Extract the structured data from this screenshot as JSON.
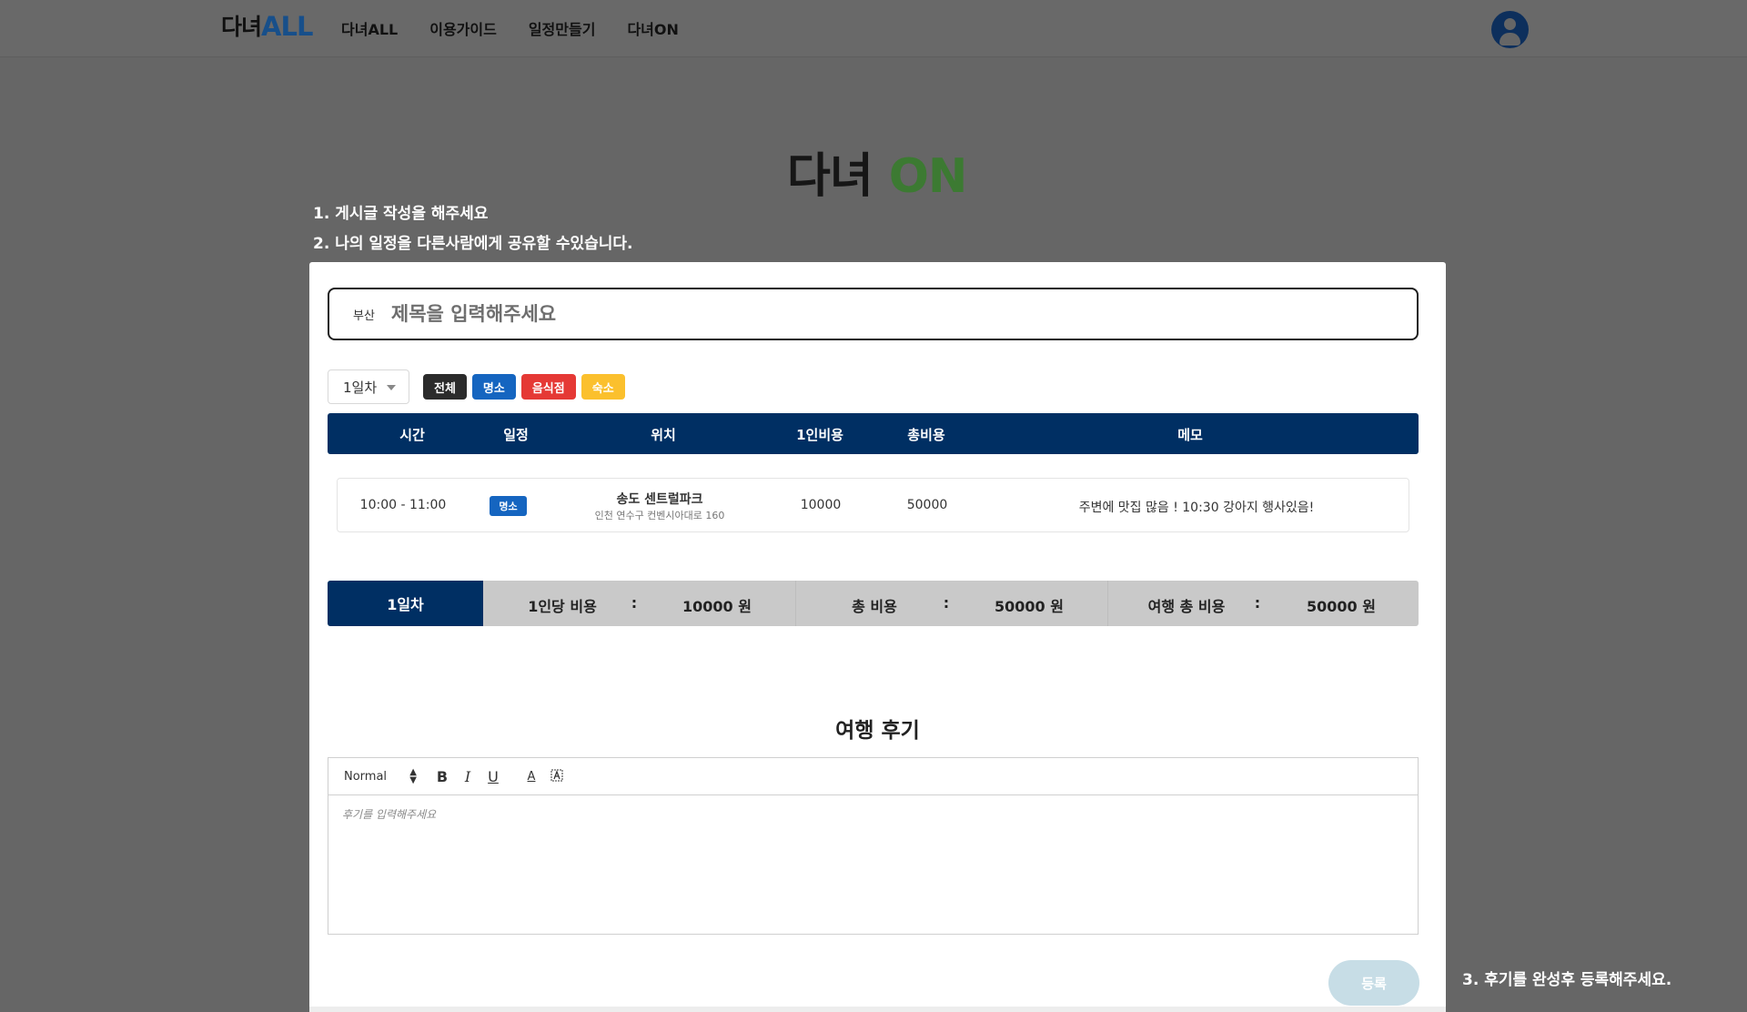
{
  "header": {
    "logo_part1": "다녀",
    "logo_part2": "ALL",
    "nav": [
      "다녀ALL",
      "이용가이드",
      "일정만들기",
      "다녀ON"
    ]
  },
  "hero": {
    "logo_part1": "다녀",
    "logo_part2": "ON"
  },
  "guides": {
    "step1": "1. 게시글 작성을 해주세요",
    "step2": "2. 나의 일정을 다른사람에게 공유할 수있습니다.",
    "step3": "3. 후기를 완성후 등록해주세요."
  },
  "post": {
    "region": "부산",
    "title_placeholder": "제목을 입력해주세요",
    "title_value": ""
  },
  "filters": {
    "day_selected": "1일차",
    "chips": [
      {
        "label": "전체",
        "color": "#2b2b2b"
      },
      {
        "label": "명소",
        "color": "#1565c0"
      },
      {
        "label": "음식점",
        "color": "#e53935"
      },
      {
        "label": "숙소",
        "color": "#fbc02d"
      }
    ]
  },
  "table": {
    "headers": [
      "시간",
      "일정",
      "위치",
      "1인비용",
      "총비용",
      "메모"
    ],
    "rows": [
      {
        "time": "10:00 - 11:00",
        "category": "명소",
        "place": "송도 센트럴파크",
        "address": "인천 연수구 컨벤시아대로 160",
        "per_person": "10000",
        "total": "50000",
        "memo": "주변에 맛집 많음 ! 10:30 강아지 행사있음!"
      }
    ]
  },
  "summary": {
    "day": "1일차",
    "per_person_label": "1인당 비용",
    "per_person_value": "10000 원",
    "total_label": "총 비용",
    "total_value": "50000 원",
    "trip_total_label": "여행 총 비용",
    "trip_total_value": "50000 원",
    "colon": ":"
  },
  "review": {
    "title": "여행 후기",
    "size_option": "Normal",
    "placeholder": "후기를 입력해주세요",
    "submit_label": "등록"
  },
  "colors": {
    "navy": "#002f63",
    "accent_green": "#3c7a32",
    "submit_disabled": "#c7dde6"
  }
}
